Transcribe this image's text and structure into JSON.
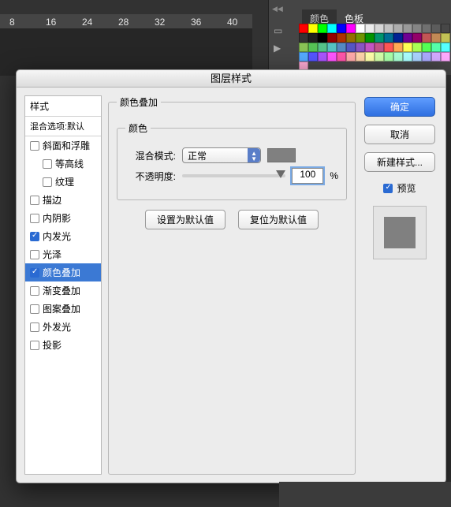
{
  "ruler": {
    "ticks": [
      "8",
      "16",
      "24",
      "28",
      "32",
      "36",
      "40"
    ]
  },
  "swatch": {
    "handle": "◀◀",
    "tabs": {
      "color": "颜色",
      "swatches": "色板"
    },
    "arrow": "▶",
    "colors": [
      "#ff0000",
      "#ffff00",
      "#00ff00",
      "#00ffff",
      "#0000ff",
      "#ff00ff",
      "#ffffff",
      "#ebebeb",
      "#d6d6d6",
      "#c2c2c2",
      "#adadad",
      "#999999",
      "#858585",
      "#707070",
      "#5c5c5c",
      "#474747",
      "#333333",
      "#1f1f1f",
      "#000000",
      "#940000",
      "#b03000",
      "#946e00",
      "#6e9400",
      "#009400",
      "#00946e",
      "#006e94",
      "#002294",
      "#6e0094",
      "#940069",
      "#c25555",
      "#c28955",
      "#c2c255",
      "#89c255",
      "#55c255",
      "#55c289",
      "#55c2c2",
      "#5589c2",
      "#5555c2",
      "#8955c2",
      "#c255c2",
      "#c25589",
      "#ff5555",
      "#ffaa55",
      "#ffff55",
      "#aaff55",
      "#55ff55",
      "#55ffaa",
      "#55ffff",
      "#55aaff",
      "#5555ff",
      "#aa55ff",
      "#ff55ff",
      "#ff55aa",
      "#ffaaaa",
      "#ffd4aa",
      "#ffffaa",
      "#d4ffaa",
      "#aaffaa",
      "#aaffd4",
      "#aaffff",
      "#aad4ff",
      "#aaaaff",
      "#d4aaff",
      "#ffaaff",
      "#ffaad4"
    ]
  },
  "dialog": {
    "title": "图层样式",
    "styles_header": "样式",
    "blend_options_label": "混合选项:默认",
    "effects": {
      "bevel": "斜面和浮雕",
      "contour": "等高线",
      "texture": "纹理",
      "stroke": "描边",
      "inner_shadow": "内阴影",
      "inner_glow": "内发光",
      "satin": "光泽",
      "color_overlay": "颜色叠加",
      "gradient_overlay": "渐变叠加",
      "pattern_overlay": "图案叠加",
      "outer_glow": "外发光",
      "drop_shadow": "投影"
    },
    "panel": {
      "legend": "颜色叠加",
      "color_legend": "颜色",
      "blend_mode_label": "混合模式:",
      "blend_mode_value": "正常",
      "opacity_label": "不透明度:",
      "opacity_value": "100",
      "opacity_unit": "%",
      "reset_default": "设置为默认值",
      "restore_default": "复位为默认值"
    },
    "actions": {
      "ok": "确定",
      "cancel": "取消",
      "new_style": "新建样式...",
      "preview": "预览"
    }
  }
}
